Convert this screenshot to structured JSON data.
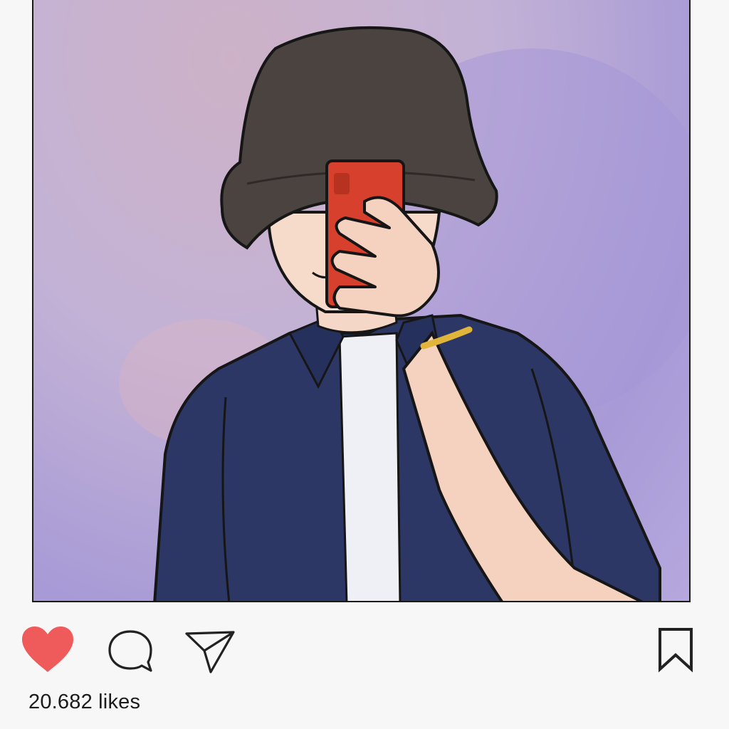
{
  "post": {
    "image": {
      "subject": "illustration-person-bucket-hat-mirror-selfie",
      "colors": {
        "background": "#c3b2d6",
        "hat": "#4b4340",
        "phone": "#d6402c",
        "shirt": "#2c3766",
        "tee": "#eef0f6",
        "skin": "#f4d7c6",
        "bracelet": "#e1b53a"
      }
    },
    "actions": {
      "like_icon": "heart-icon",
      "comment_icon": "speech-bubble-icon",
      "share_icon": "paper-plane-icon",
      "save_icon": "bookmark-icon",
      "like_color": "#ef5a5a",
      "icon_color": "#222222"
    },
    "likes_text": "20.682 likes"
  }
}
